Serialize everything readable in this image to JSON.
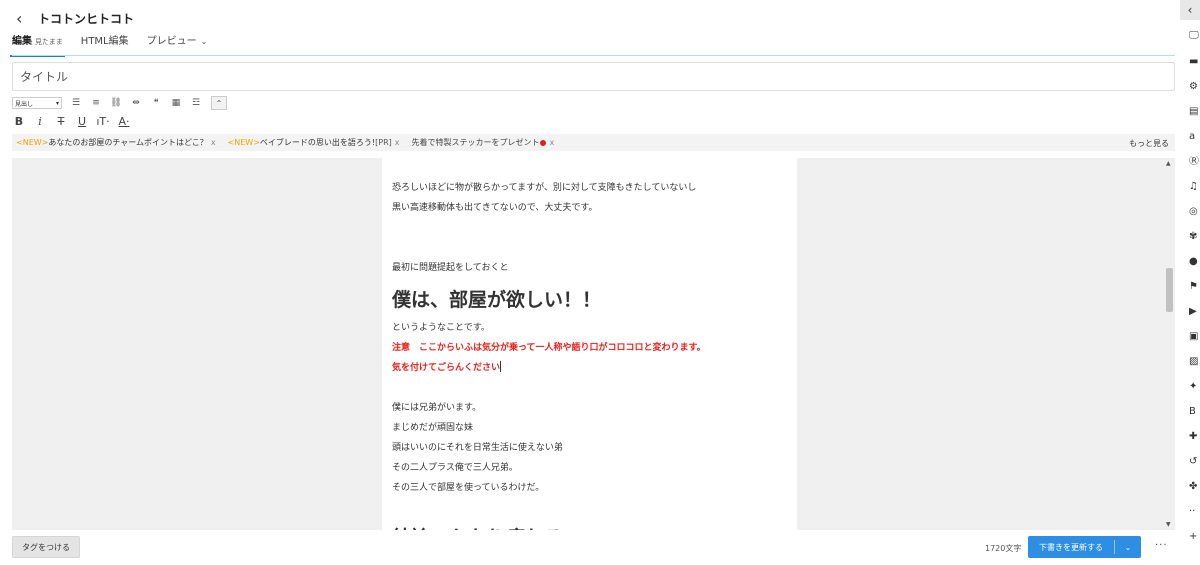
{
  "header": {
    "back_icon": "chevron-left",
    "blog_title": "トコトンヒトコト"
  },
  "tabs": [
    {
      "label": "編集",
      "sub": "見たまま"
    },
    {
      "label": "HTML編集"
    },
    {
      "label": "プレビュー",
      "chevron": "⌄"
    }
  ],
  "title_field": {
    "placeholder": "タイトル",
    "value": ""
  },
  "toolbar": {
    "heading_select": "見出し",
    "heading_caret": "▾",
    "row1_icons": [
      "bulleted-list-icon",
      "numbered-list-icon",
      "link-icon",
      "read-more-icon",
      "quote-icon",
      "table-icon",
      "divider-icon"
    ],
    "row1_glyphs": [
      "☰",
      "≡",
      "⛓",
      "⇹",
      "❝",
      "▦",
      "☲"
    ],
    "collapse_glyph": "⌃",
    "row2": [
      {
        "name": "bold",
        "glyph": "B"
      },
      {
        "name": "italic",
        "glyph": "i"
      },
      {
        "name": "strikethrough",
        "glyph": "T"
      },
      {
        "name": "underline",
        "glyph": "U"
      },
      {
        "name": "font-size",
        "glyph": "ıT·"
      },
      {
        "name": "font-color",
        "glyph": "A·"
      }
    ]
  },
  "news": {
    "items": [
      {
        "prefix": "<NEW>",
        "text": "あなたのお部屋のチャームポイントはどこ？",
        "close": "x"
      },
      {
        "prefix": "<NEW>",
        "text": "ベイブレードの思い出を語ろう!",
        "tag": "[PR]",
        "close": "x"
      },
      {
        "prefix": "",
        "text": "先着で特製ステッカーをプレゼント",
        "pin": true,
        "close": "x"
      }
    ],
    "more": "もっと見る",
    "accent_color": "#f0a20a"
  },
  "editor": {
    "lines_top": [
      "恐ろしいほどに物が散らかってますが、別に対して支障もきたしていないし",
      "黒い高速移動体も出てきてないので、大丈夫です。"
    ],
    "lead": "最初に問題提起をしておくと",
    "heading1": "僕は、部屋が欲しい！！",
    "after_heading": "というようなことです。",
    "warning_line1": "注意　ここからいふは気分が乗って一人称や語り口がコロコロと変わります。",
    "warning_line2": "気を付けてごらんください",
    "warning_color": "#e8201b",
    "paragraph": [
      "僕には兄弟がいます。",
      "まじめだが頑固な妹",
      "頭はいいのにそれを日常生活に使えない弟",
      "その二人プラス俺で三人兄弟。",
      "その三人で部屋を使っているわけだ。"
    ],
    "heading2": "結論、かなり疲れる"
  },
  "footer": {
    "tag_button": "タグをつける",
    "char_count": "1720文字",
    "update_button": "下書きを更新する",
    "update_chevron": "⌄",
    "more": "···",
    "primary_color": "#2d8ee3"
  },
  "sidebar": {
    "collapse": "‹",
    "icons": [
      {
        "name": "monitor-icon",
        "glyph": "🖵"
      },
      {
        "name": "folder-icon",
        "glyph": "▬"
      },
      {
        "name": "gear-icon",
        "glyph": "⚙"
      },
      {
        "name": "book-icon",
        "glyph": "▤"
      },
      {
        "name": "amazon-icon",
        "glyph": "a"
      },
      {
        "name": "rakuten-icon",
        "glyph": "Ⓡ"
      },
      {
        "name": "music-icon",
        "glyph": "♫"
      },
      {
        "name": "instagram-icon",
        "glyph": "◎"
      },
      {
        "name": "gift-icon",
        "glyph": "✾"
      },
      {
        "name": "flickr-icon",
        "glyph": "●"
      },
      {
        "name": "flag-icon",
        "glyph": "⚑"
      },
      {
        "name": "youtube-icon",
        "glyph": "▶"
      },
      {
        "name": "tv-icon",
        "glyph": "▣"
      },
      {
        "name": "photo-icon",
        "glyph": "▨"
      },
      {
        "name": "twitter-icon",
        "glyph": "✦"
      },
      {
        "name": "hatena-icon",
        "glyph": "B"
      },
      {
        "name": "restaurant-icon",
        "glyph": "✚"
      },
      {
        "name": "recycle-icon",
        "glyph": "↺"
      },
      {
        "name": "puzzle-icon",
        "glyph": "✤"
      },
      {
        "name": "more-icon",
        "glyph": "··"
      },
      {
        "name": "plus-icon",
        "glyph": "+"
      }
    ]
  }
}
